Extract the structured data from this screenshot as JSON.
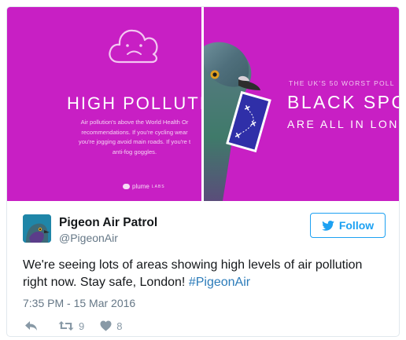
{
  "media": {
    "left_image": {
      "headline": "HIGH POLLUTI",
      "body_lines": [
        "Air pollution's above the World Health Or",
        "recommendations. If you're cycling wear",
        "you're jogging avoid main roads. If you're t",
        "anti-fog goggles."
      ],
      "logo_text": "plume",
      "logo_sub": "LABS",
      "background": "#c81fc4"
    },
    "right_image": {
      "subheading": "THE UK'S 50 WORST POLL",
      "headline_line1": "BLACK SPO",
      "headline_line2": "ARE ALL IN LON",
      "background": "#c81fc4"
    }
  },
  "tweet": {
    "author_name": "Pigeon Air Patrol",
    "author_handle": "@PigeonAir",
    "follow_label": "Follow",
    "text": "We're seeing lots of areas showing high levels of air pollution right now. Stay safe, London! ",
    "hashtag": "#PigeonAir",
    "timestamp": "7:35 PM - 15 Mar 2016",
    "retweet_count": "9",
    "like_count": "8"
  },
  "colors": {
    "accent": "#1da1f2",
    "hashtag": "#2b7bb9",
    "muted": "#657786",
    "media_magenta": "#c81fc4"
  },
  "icons": {
    "cloud": "sad-cloud-icon",
    "follow": "twitter-bird-icon",
    "reply": "reply-icon",
    "retweet": "retweet-icon",
    "like": "heart-icon"
  }
}
